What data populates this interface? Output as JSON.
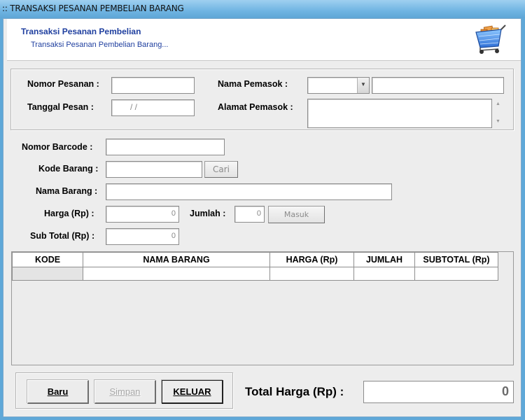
{
  "window": {
    "title": ":: TRANSAKSI PESANAN PEMBELIAN BARANG"
  },
  "header": {
    "title": "Transaksi Pesanan Pembelian",
    "subtitle": "Transaksi Pesanan Pembelian Barang...",
    "icon": "shopping-cart-icon"
  },
  "order": {
    "nomor_pesanan_label": "Nomor Pesanan :",
    "nomor_pesanan_value": "",
    "tanggal_pesan_label": "Tanggal Pesan :",
    "tanggal_pesan_value": "/ /",
    "nama_pemasok_label": "Nama Pemasok :",
    "nama_pemasok_value": "",
    "alamat_pemasok_label": "Alamat Pemasok :",
    "alamat_pemasok_value": ""
  },
  "item": {
    "barcode_label": "Nomor  Barcode :",
    "barcode_value": "",
    "kode_label": "Kode Barang :",
    "kode_value": "",
    "cari_label": "Cari",
    "nama_label": "Nama Barang :",
    "nama_value": "",
    "harga_label": "Harga (Rp) :",
    "harga_value": "0",
    "jumlah_label": "Jumlah :",
    "jumlah_value": "0",
    "masuk_label": "Masuk",
    "subtotal_label": "Sub Total (Rp) :",
    "subtotal_value": "0"
  },
  "grid": {
    "columns": [
      "KODE",
      "NAMA BARANG",
      "HARGA (Rp)",
      "JUMLAH",
      "SUBTOTAL (Rp)"
    ],
    "rows": [
      [
        "",
        "",
        "",
        "",
        ""
      ]
    ]
  },
  "actions": {
    "baru": "Baru",
    "simpan": "Simpan",
    "keluar": "KELUAR"
  },
  "total": {
    "label": "Total Harga (Rp) :",
    "value": "0"
  }
}
